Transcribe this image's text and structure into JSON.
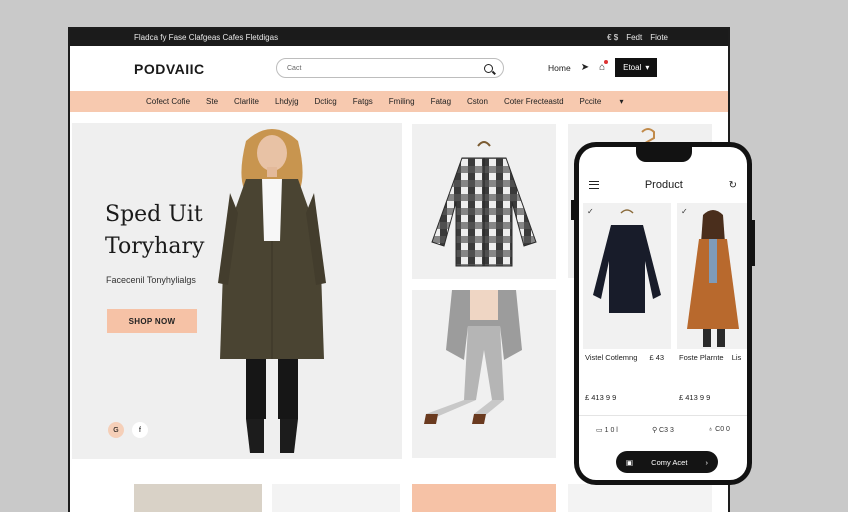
{
  "topbar": {
    "promo": "Fladca fy Fase Clafgeas Cafes Fletdigas",
    "links": [
      "€ $",
      "Fedt",
      "Fiote"
    ]
  },
  "header": {
    "logo": "PODVAIIC",
    "search_placeholder": "Cact",
    "home": "Home",
    "shop": "Etoal"
  },
  "nav": [
    "Cofect Cofie",
    "Ste",
    "Clarlite",
    "Lhdyjg",
    "Dcticg",
    "Fatgs",
    "Fmiling",
    "Fatag",
    "Cston",
    "Coter Frecteastd",
    "Pccite"
  ],
  "hero": {
    "title_line1": "Sped Uit",
    "title_line2": "Toryhary",
    "subtitle": "Facecenil Tonyhylialgs",
    "cta": "SHOP NOW",
    "dot_a": "G",
    "dot_b": "f"
  },
  "phone": {
    "title": "Product",
    "products": [
      {
        "name": "Vistel Cotlemng",
        "tag": "£ 43",
        "price": "£ 413 9 9"
      },
      {
        "name": "Foste Plarnte",
        "tag": "Lis",
        "price": "£ 413 9 9"
      }
    ],
    "icon_labels": [
      "1 0 l",
      "C3 3",
      "C0 0"
    ],
    "cta": "Comy Acet"
  },
  "colors": {
    "accent": "#f7c9af",
    "dark": "#1b1b1b",
    "coat": "#4a4432",
    "camel": "#b8692d"
  }
}
